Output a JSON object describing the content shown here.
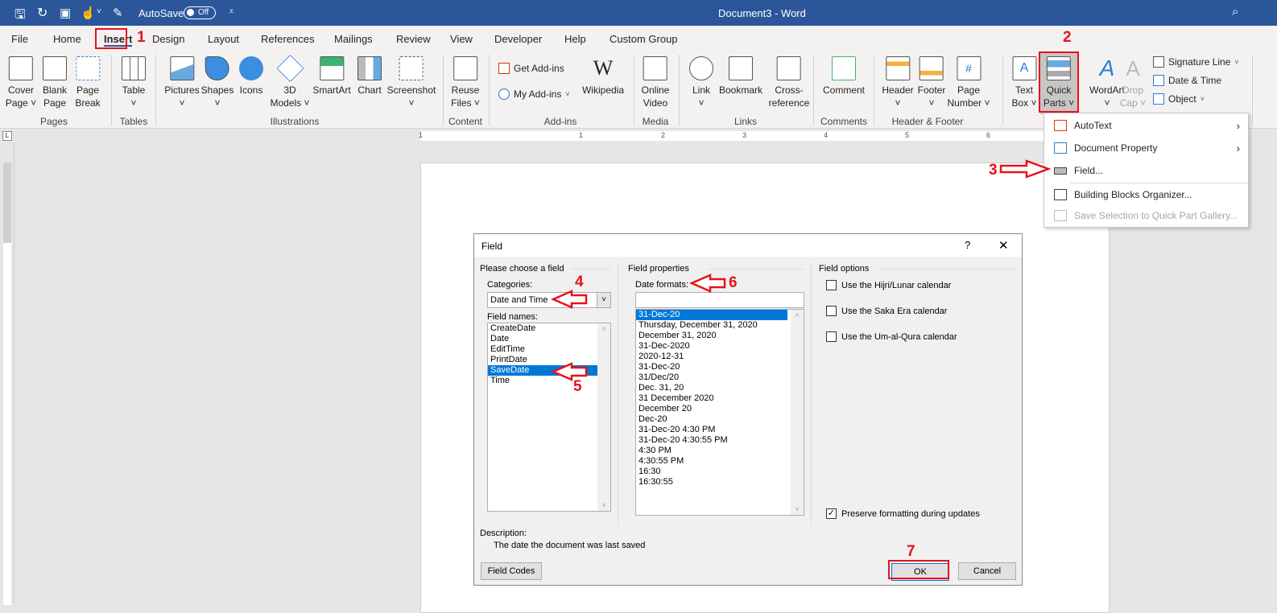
{
  "titlebar": {
    "autosave": "AutoSave",
    "toggle": "Off",
    "title": "Document3  -  Word"
  },
  "tabs": [
    "File",
    "Home",
    "Insert",
    "Design",
    "Layout",
    "References",
    "Mailings",
    "Review",
    "View",
    "Developer",
    "Help",
    "Custom Group"
  ],
  "ribbon": {
    "cover": [
      "Cover",
      "Page ˅"
    ],
    "blank": [
      "Blank",
      "Page"
    ],
    "break": [
      "Page",
      "Break"
    ],
    "table": [
      "Table",
      "˅"
    ],
    "pictures": [
      "Pictures",
      "˅"
    ],
    "shapes": [
      "Shapes",
      "˅"
    ],
    "icons": [
      "Icons",
      ""
    ],
    "models": [
      "3D",
      "Models ˅"
    ],
    "smartart": [
      "SmartArt",
      ""
    ],
    "chart": [
      "Chart",
      ""
    ],
    "screenshot": [
      "Screenshot",
      "˅"
    ],
    "reuse": [
      "Reuse",
      "Files ˅"
    ],
    "getaddins": "Get Add-ins",
    "myaddins": "My Add-ins",
    "wikipedia": "Wikipedia",
    "video": [
      "Online",
      "Video"
    ],
    "link": [
      "Link",
      "˅"
    ],
    "bookmark": [
      "Bookmark",
      ""
    ],
    "crossref": [
      "Cross-",
      "reference"
    ],
    "comment": [
      "Comment",
      ""
    ],
    "header": [
      "Header",
      "˅"
    ],
    "footer": [
      "Footer",
      "˅"
    ],
    "pagenum": [
      "Page",
      "Number ˅"
    ],
    "textbox": [
      "Text",
      "Box ˅"
    ],
    "quickparts": [
      "Quick",
      "Parts ˅"
    ],
    "wordart": [
      "WordArt",
      "˅"
    ],
    "dropcap": [
      "Drop",
      "Cap ˅"
    ],
    "signature": "Signature Line",
    "datetime": "Date & Time",
    "object": "Object",
    "groups": [
      "Pages",
      "Tables",
      "Illustrations",
      "Content",
      "Add-ins",
      "Media",
      "Links",
      "Comments",
      "Header & Footer"
    ]
  },
  "ruler": [
    "1",
    "1",
    "2",
    "3",
    "4",
    "5",
    "6"
  ],
  "menu": {
    "autotext": "AutoText",
    "docprop": "Document Property",
    "field": "Field...",
    "organizer": "Building Blocks Organizer...",
    "save": "Save Selection to Quick Part Gallery..."
  },
  "dialog": {
    "title": "Field",
    "help": "?",
    "close": "✕",
    "choose": "Please choose a field",
    "categories_label": "Categories:",
    "category": "Date and Time",
    "fieldnames_label": "Field names:",
    "fieldnames": [
      "CreateDate",
      "Date",
      "EditTime",
      "PrintDate",
      "SaveDate",
      "Time"
    ],
    "props": "Field properties",
    "dateformats_label": "Date formats:",
    "dateformat_value": "",
    "formats": [
      "31-Dec-20",
      "Thursday, December 31, 2020",
      "December 31, 2020",
      "31-Dec-2020",
      "2020-12-31",
      "31-Dec-20",
      "31/Dec/20",
      "Dec. 31, 20",
      "31 December 2020",
      "December 20",
      "Dec-20",
      "31-Dec-20 4:30 PM",
      "31-Dec-20 4:30:55 PM",
      "4:30 PM",
      "4:30:55 PM",
      "16:30",
      "16:30:55"
    ],
    "options": "Field options",
    "hijri": "Use the Hijri/Lunar calendar",
    "saka": "Use the Saka Era calendar",
    "umalqura": "Use the Um-al-Qura calendar",
    "preserve": "Preserve formatting during updates",
    "desc_label": "Description:",
    "desc": "The date the document was last saved",
    "fieldcodes": "Field Codes",
    "ok": "OK",
    "cancel": "Cancel"
  },
  "annotations": [
    "1",
    "2",
    "3",
    "4",
    "5",
    "6",
    "7"
  ],
  "colors": {
    "accent": "#2b579a",
    "annotation": "#e8121b",
    "selection": "#0078d7"
  }
}
